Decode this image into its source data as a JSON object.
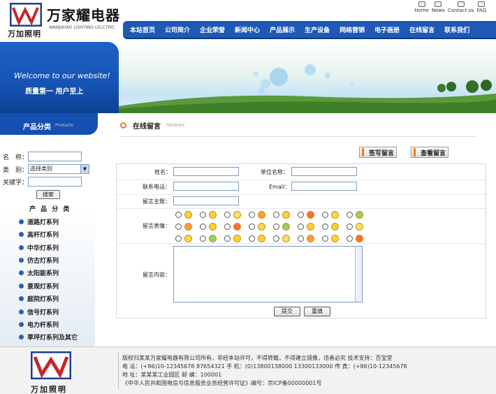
{
  "header": {
    "logo_sub": "万加照明",
    "brand_cn": "万家耀电器",
    "brand_en": "WANJIAYAO LIGHTING LELCTRIC",
    "top_links": [
      "Home",
      "News",
      "Contact us",
      "FAQ"
    ]
  },
  "nav": [
    "本站首页",
    "公司简介",
    "企业荣誉",
    "新闻中心",
    "产品展示",
    "生产设备",
    "网络营销",
    "电子画册",
    "在线留言",
    "联系我们"
  ],
  "banner": {
    "welcome": "Welcome to our website!",
    "slogan": "质量第一  用户至上"
  },
  "sidebar": {
    "cat_title": "产品分类",
    "cat_en": "Products",
    "name_label": "名　称：",
    "type_label": "类　别：",
    "type_selected": "选择类别",
    "keyword_label": "关键字：",
    "search_btn": "搜索",
    "prod_head": "产 品 分 类",
    "items": [
      "道路灯系列",
      "高杆灯系列",
      "中华灯系列",
      "仿古灯系列",
      "太阳能系列",
      "景观灯系列",
      "庭院灯系列",
      "信号灯系列",
      "电力杆系列",
      "草坪灯系列及其它"
    ]
  },
  "main": {
    "title": "在线留言",
    "title_en": "FEEDBACK",
    "btn_write": "签写留言",
    "btn_view": "查看留言",
    "form": {
      "name_label": "姓名：",
      "company_label": "单位名称：",
      "phone_label": "联系电话：",
      "email_label": "Email：",
      "subject_label": "留言主题：",
      "emote_label": "留言表情：",
      "content_label": "留言内容：",
      "submit": "提交",
      "reset": "重填"
    }
  },
  "footer": {
    "logo_sub": "万加照明",
    "line1": "版权归某某万家耀电器有限公司所有，非经本站许可，不得转载，不得建立镜像，违者必究  技术支持：百宝堂",
    "line2": "电  话：(+86)10-12345678  87654321  手  机：(0)13800138000  13300133000    传  真：(+86)10-12345678",
    "line3": "地  址：某某某工业园区        邮  编：100001",
    "line4": "《中华人民共和国电信与信息服务业务经营许可证》编号：京ICP备00000001号"
  },
  "colors": {
    "nav_blue": "#1f59b5",
    "accent_orange": "#f07d1c",
    "sidebar_blue": "#1450b1"
  }
}
